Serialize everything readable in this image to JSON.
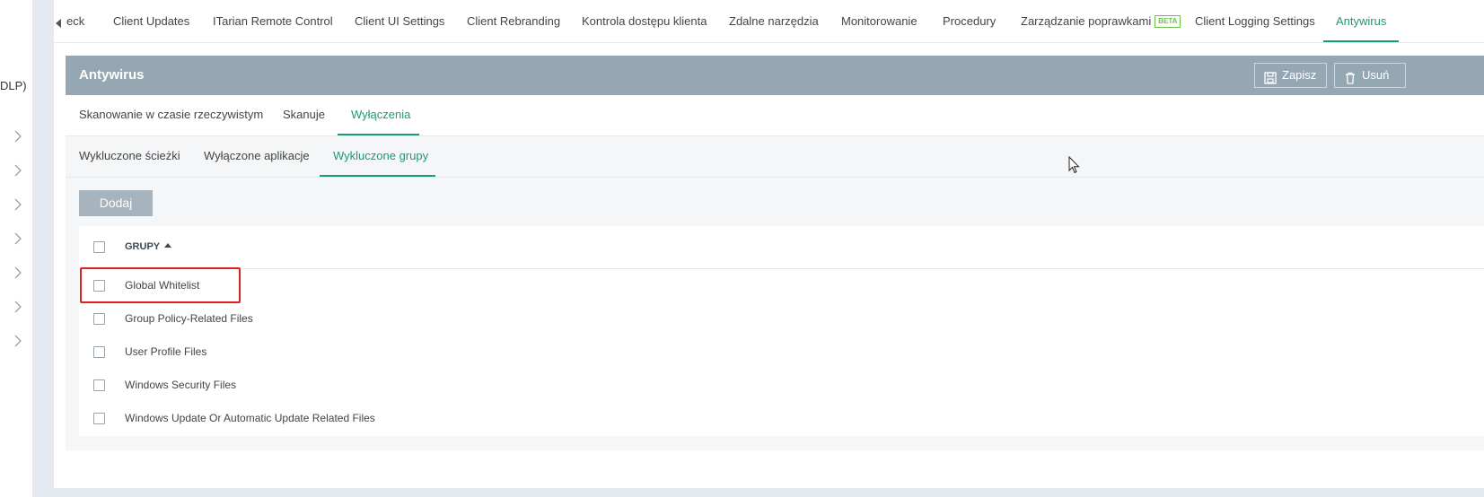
{
  "sidebar": {
    "label": "DLP)"
  },
  "tabs": [
    {
      "label": "eck"
    },
    {
      "label": "Client Updates"
    },
    {
      "label": "ITarian Remote Control"
    },
    {
      "label": "Client UI Settings"
    },
    {
      "label": "Client Rebranding"
    },
    {
      "label": "Kontrola dostępu klienta"
    },
    {
      "label": "Zdalne narzędzia"
    },
    {
      "label": "Monitorowanie"
    },
    {
      "label": "Procedury"
    },
    {
      "label": "Zarządzanie poprawkami",
      "badge": "BETA"
    },
    {
      "label": "Client Logging Settings"
    },
    {
      "label": "Antywirus",
      "active": true
    }
  ],
  "panel": {
    "title": "Antywirus",
    "save_label": "Zapisz",
    "delete_label": "Usuń"
  },
  "subtabs": [
    {
      "label": "Skanowanie w czasie rzeczywistym"
    },
    {
      "label": "Skanuje"
    },
    {
      "label": "Wyłączenia",
      "active": true
    }
  ],
  "subtabs2": [
    {
      "label": "Wykluczone ścieżki"
    },
    {
      "label": "Wyłączone aplikacje"
    },
    {
      "label": "Wykluczone grupy",
      "active": true
    }
  ],
  "add_label": "Dodaj",
  "table": {
    "header": "GRUPY",
    "rows": [
      "Global Whitelist",
      "Group Policy-Related Files",
      "User Profile Files",
      "Windows Security Files",
      "Windows Update Or Automatic Update Related Files"
    ]
  },
  "colors": {
    "accent": "#1a9a79",
    "header_bg": "#96a7b4",
    "highlight": "#e02020"
  }
}
